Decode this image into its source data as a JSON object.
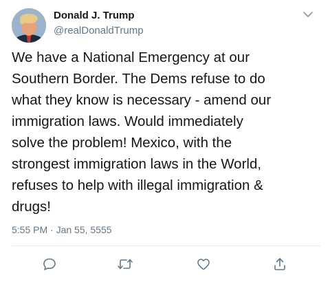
{
  "tweet": {
    "author_name": "Donald J. Trump",
    "author_handle": "@realDonaldTrump",
    "text": "We have a National Emergency at our\nSouthern Border. The Dems refuse to do\nwhat they know is necessary - amend our\nimmigration laws. Would immediately\nsolve the problem! Mexico, with the\nstrongest immigration laws in the World,\nrefuses to help with illegal immigration &\ndrugs!",
    "timestamp": "5:55 PM · Jan 55, 5555"
  },
  "actions": [
    {
      "icon": "reply-icon"
    },
    {
      "icon": "retweet-icon"
    },
    {
      "icon": "like-icon"
    },
    {
      "icon": "share-icon"
    }
  ],
  "colors": {
    "text": "#14171a",
    "secondary": "#657786",
    "divider": "#e1e8ed"
  }
}
